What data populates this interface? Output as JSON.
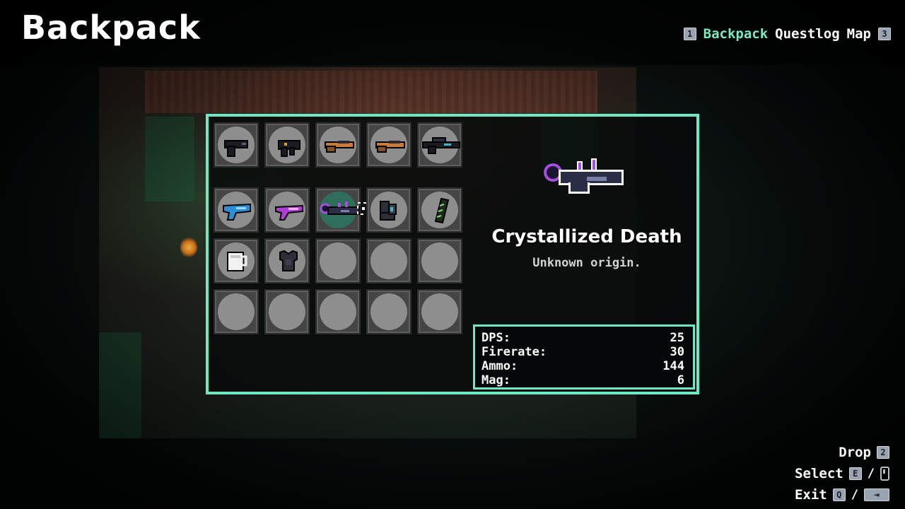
{
  "header": {
    "title": "Backpack",
    "prev_key": "1",
    "next_key": "3",
    "tabs": [
      {
        "label": "Backpack",
        "active": true
      },
      {
        "label": "Questlog",
        "active": false
      },
      {
        "label": "Map",
        "active": false
      }
    ]
  },
  "inventory": {
    "equipped": [
      {
        "icon": "pistol-dark-icon"
      },
      {
        "icon": "smg-dark-icon"
      },
      {
        "icon": "shotgun-orange-icon"
      },
      {
        "icon": "shotgun-orange-icon"
      },
      {
        "icon": "rifle-dark-icon"
      }
    ],
    "storage": [
      {
        "icon": "blaster-blue-icon"
      },
      {
        "icon": "blaster-purple-icon"
      },
      {
        "icon": "crystal-gun-icon",
        "selected": true
      },
      {
        "icon": "boots-icon"
      },
      {
        "icon": "green-scroll-icon"
      },
      {
        "icon": "mug-icon"
      },
      {
        "icon": "chest-armor-icon"
      },
      {
        "icon": ""
      },
      {
        "icon": ""
      },
      {
        "icon": ""
      },
      {
        "icon": ""
      },
      {
        "icon": ""
      },
      {
        "icon": ""
      },
      {
        "icon": ""
      },
      {
        "icon": ""
      }
    ]
  },
  "detail": {
    "icon": "crystal-gun-icon",
    "name": "Crystallized Death",
    "description": "Unknown origin.",
    "stats": [
      {
        "label": "DPS:",
        "value": "25"
      },
      {
        "label": "Firerate:",
        "value": "30"
      },
      {
        "label": "Ammo:",
        "value": "144"
      },
      {
        "label": "Mag:",
        "value": "6"
      }
    ]
  },
  "hints": {
    "drop_label": "Drop",
    "drop_key": "2",
    "select_label": "Select",
    "select_key": "E",
    "select_separator": "/",
    "exit_label": "Exit",
    "exit_key": "Q",
    "exit_separator": "/",
    "exit_alt_key": "⇥"
  },
  "colors": {
    "accent": "#6ee7c2",
    "active_tab": "#7de8c6",
    "slot_bg": "#8e8e8e",
    "slot_selected": "#2f6e5b"
  }
}
